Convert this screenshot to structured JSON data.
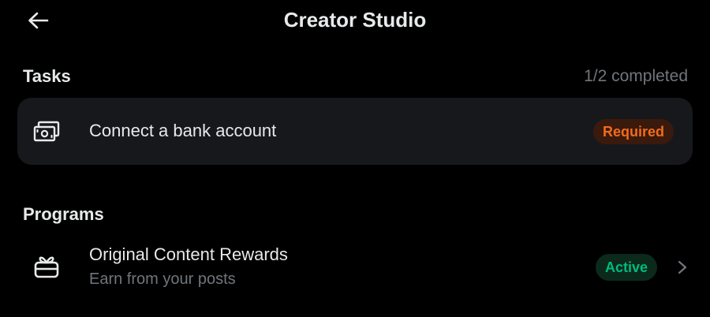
{
  "header": {
    "title": "Creator Studio",
    "back_icon": "arrow-left-icon"
  },
  "tasks": {
    "heading": "Tasks",
    "progress": "1/2 completed",
    "items": [
      {
        "icon": "money-icon",
        "label": "Connect a bank account",
        "badge": "Required",
        "badge_color": "#f26b1d"
      }
    ]
  },
  "programs": {
    "heading": "Programs",
    "items": [
      {
        "icon": "gift-icon",
        "name": "Original Content Rewards",
        "description": "Earn from your posts",
        "badge": "Active",
        "badge_color": "#00ba7c",
        "chevron_icon": "chevron-right-icon"
      }
    ]
  },
  "colors": {
    "background": "#000000",
    "card": "#16181c",
    "text": "#e7e9ea",
    "muted": "#71767b"
  }
}
